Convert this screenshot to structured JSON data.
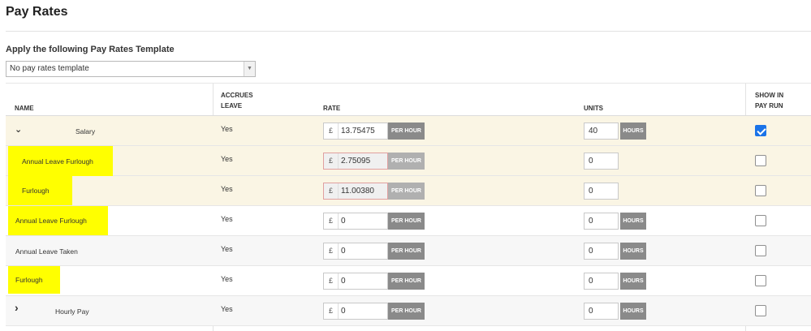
{
  "page": {
    "title": "Pay Rates"
  },
  "template": {
    "label": "Apply the following Pay Rates Template",
    "selected": "No pay rates template",
    "arrow": "▼"
  },
  "table": {
    "headers": {
      "name": "NAME",
      "accrues1": "ACCRUES",
      "accrues2": "LEAVE",
      "rate": "RATE",
      "units": "UNITS",
      "show1": "SHOW IN",
      "show2": "PAY RUN"
    },
    "rows": [
      {
        "name": "Salary",
        "accrues": "Yes",
        "currency": "£",
        "rate": "13.75475",
        "rate_unit": "PER HOUR",
        "units": "40",
        "units_label": "HOURS",
        "show": true,
        "chevron": "⌄"
      },
      {
        "name": "Annual Leave Furlough",
        "accrues": "Yes",
        "currency": "£",
        "rate": "2.75095",
        "rate_unit": "PER HOUR",
        "units": "0",
        "show": false
      },
      {
        "name": "Furlough",
        "accrues": "Yes",
        "currency": "£",
        "rate": "11.00380",
        "rate_unit": "PER HOUR",
        "units": "0",
        "show": false
      },
      {
        "name": "Annual Leave Furlough",
        "accrues": "Yes",
        "currency": "£",
        "rate": "0",
        "rate_unit": "PER HOUR",
        "units": "0",
        "units_label": "HOURS",
        "show": false
      },
      {
        "name": "Annual Leave Taken",
        "accrues": "Yes",
        "currency": "£",
        "rate": "0",
        "rate_unit": "PER HOUR",
        "units": "0",
        "units_label": "HOURS",
        "show": false
      },
      {
        "name": "Furlough",
        "accrues": "Yes",
        "currency": "£",
        "rate": "0",
        "rate_unit": "PER HOUR",
        "units": "0",
        "units_label": "HOURS",
        "show": false
      },
      {
        "name": "Hourly Pay",
        "accrues": "Yes",
        "currency": "£",
        "rate": "0",
        "rate_unit": "PER HOUR",
        "units": "0",
        "units_label": "HOURS",
        "show": false,
        "chevron": "›"
      }
    ]
  },
  "colors": {
    "highlight": "#ffff00",
    "expanded_bg": "#faf5e4",
    "checkbox_on": "#1a73e8",
    "tag_gray": "#8a8a8a"
  }
}
